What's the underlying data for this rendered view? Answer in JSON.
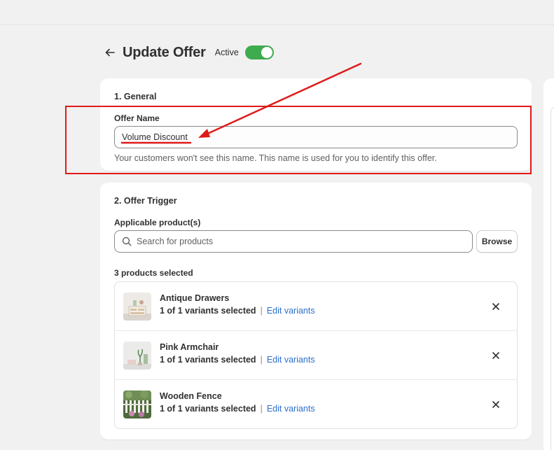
{
  "header": {
    "title": "Update Offer",
    "status_label": "Active",
    "status_on": true
  },
  "general": {
    "section_title": "1. General",
    "offer_name_label": "Offer Name",
    "offer_name_value": "Volume Discount",
    "help_text": "Your customers won't see this name. This name is used for you to identify this offer."
  },
  "trigger": {
    "section_title": "2. Offer Trigger",
    "applicable_label": "Applicable product(s)",
    "search_placeholder": "Search for products",
    "browse_label": "Browse",
    "selected_count": "3 products selected",
    "products": [
      {
        "name": "Antique Drawers",
        "variants": "1 of 1 variants selected",
        "separator": "|",
        "edit_label": "Edit variants"
      },
      {
        "name": "Pink Armchair",
        "variants": "1 of 1 variants selected",
        "separator": "|",
        "edit_label": "Edit variants"
      },
      {
        "name": "Wooden Fence",
        "variants": "1 of 1 variants selected",
        "separator": "|",
        "edit_label": "Edit variants"
      }
    ]
  },
  "colors": {
    "toggle_on": "#3fab4f",
    "link": "#2c6ecb",
    "annotation": "#e01a1a"
  },
  "icons": {
    "back": "arrow-left-icon",
    "search": "search-icon",
    "remove": "close-icon"
  }
}
